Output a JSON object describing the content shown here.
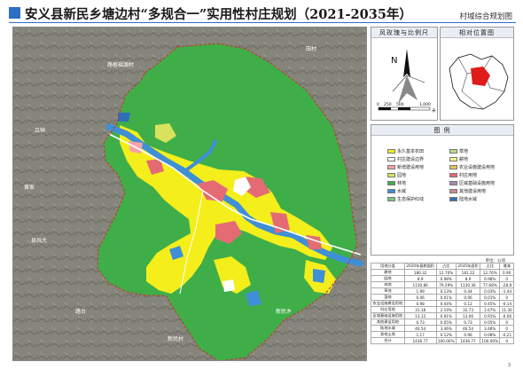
{
  "header": {
    "title": "安义县新民乡塘边村“多规合一”实用性村庄规划（2021-2035年）",
    "sheet_name": "村域综合规划图",
    "accent": "#2b6ec3"
  },
  "map": {
    "place_labels": [
      "路根福源村",
      "吕钟",
      "黄家",
      "县共大",
      "新民村",
      "路台",
      "田村",
      "新民乡"
    ],
    "colors": {
      "forest": "#3fae49",
      "farmland": "#f4ee1b",
      "village": "#e46b73",
      "water": "#3e8fd6",
      "orchard": "#d9e25d",
      "road": "#ffffff",
      "boundary": "#c0392b",
      "terrain": "#86857b"
    }
  },
  "panels": {
    "scale_title": "风玫瑰与比例尺",
    "location_title": "相对位置图",
    "north_letter": "N",
    "scale_ticks": [
      "0",
      "250",
      "500",
      "1,000"
    ],
    "scale_unit": "米",
    "legend_title": "图   例"
  },
  "legend": [
    {
      "label": "永久基本农田",
      "color": "#f4ee1b"
    },
    {
      "label": "草地",
      "color": "#b8d98a"
    },
    {
      "label": "村庄建设边界",
      "color": "#ffffff"
    },
    {
      "label": "耕地",
      "color": "#f7f29a"
    },
    {
      "label": "新增建设用地",
      "color": "#f7a2a8"
    },
    {
      "label": "农业设施建设用地",
      "color": "#e8c15a"
    },
    {
      "label": "园地",
      "color": "#d9e25d"
    },
    {
      "label": "村庄用地",
      "color": "#e46b73"
    },
    {
      "label": "林地",
      "color": "#3fae49"
    },
    {
      "label": "区域基础设施用地",
      "color": "#a58ab6"
    },
    {
      "label": "水域",
      "color": "#3e8fd6"
    },
    {
      "label": "其他建设用地",
      "color": "#c88d8d"
    },
    {
      "label": "生态保护红线",
      "color": "#7bc67e"
    },
    {
      "label": "陆地水域",
      "color": "#2e6fb8"
    }
  ],
  "table": {
    "unit_note": "单位：公顷",
    "head": [
      "用地分类",
      "2020年基期面积",
      "占比",
      "2035年面积",
      "占比",
      "增减"
    ],
    "rows": [
      [
        "耕地",
        "180.32",
        "12.70%",
        "181.22",
        "12.76%",
        "0.90"
      ],
      [
        "园地",
        "8.9",
        "0.98%",
        "8.9",
        "0.98%",
        "0"
      ],
      [
        "林地",
        "1130.86",
        "79.29%",
        "1130.36",
        "77.68%",
        "-28.8"
      ],
      [
        "草地",
        "1.99",
        "0.13%",
        "0.44",
        "0.03%",
        "-1.44"
      ],
      [
        "湿地",
        "0.06",
        "0.01%",
        "0.06",
        "0.01%",
        "0"
      ],
      [
        "农业设施建设用地",
        "0.98",
        "0.44%",
        "0.12",
        "0.45%",
        "-0.14"
      ],
      [
        "村庄用地",
        "31.18",
        "2.19%",
        "32.73",
        "2.67%",
        "11.30"
      ],
      [
        "区域基础设施用地",
        "13.12",
        "0.91%",
        "13.06",
        "0.91%",
        "-0.06"
      ],
      [
        "其他建设用地",
        "0.73",
        "0.05%",
        "0.73",
        "0.05%",
        "0"
      ],
      [
        "陆地水域",
        "46.54",
        "3.46%",
        "46.54",
        "3.46%",
        "0"
      ],
      [
        "其他土地",
        "1.17",
        "0.12%",
        "0.96",
        "0.08%",
        "-0.21"
      ],
      [
        "合计",
        "1436.77",
        "100.00%",
        "1436.77",
        "100.00%",
        "0"
      ]
    ]
  },
  "page_number": "3"
}
